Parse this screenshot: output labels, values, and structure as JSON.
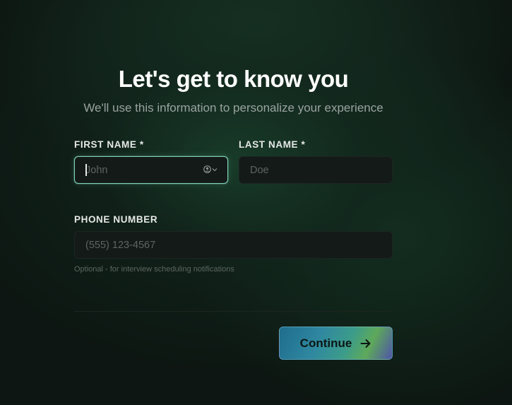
{
  "form": {
    "title": "Let's get to know you",
    "subtitle": "We'll use this information to personalize your experience",
    "first_name": {
      "label": "FIRST NAME *",
      "placeholder": "John",
      "value": ""
    },
    "last_name": {
      "label": "LAST NAME *",
      "placeholder": "Doe",
      "value": ""
    },
    "phone": {
      "label": "PHONE NUMBER",
      "placeholder": "(555) 123-4567",
      "value": "",
      "hint": "Optional - for interview scheduling notifications"
    },
    "continue_label": "Continue"
  },
  "icons": {
    "autofill": "contact-autofill-icon",
    "continue_arrow": "arrow-right-icon"
  },
  "colors": {
    "focus_border": "#7fd1b5",
    "field_bg": "#131a18",
    "page_bg": "#0d1612"
  }
}
